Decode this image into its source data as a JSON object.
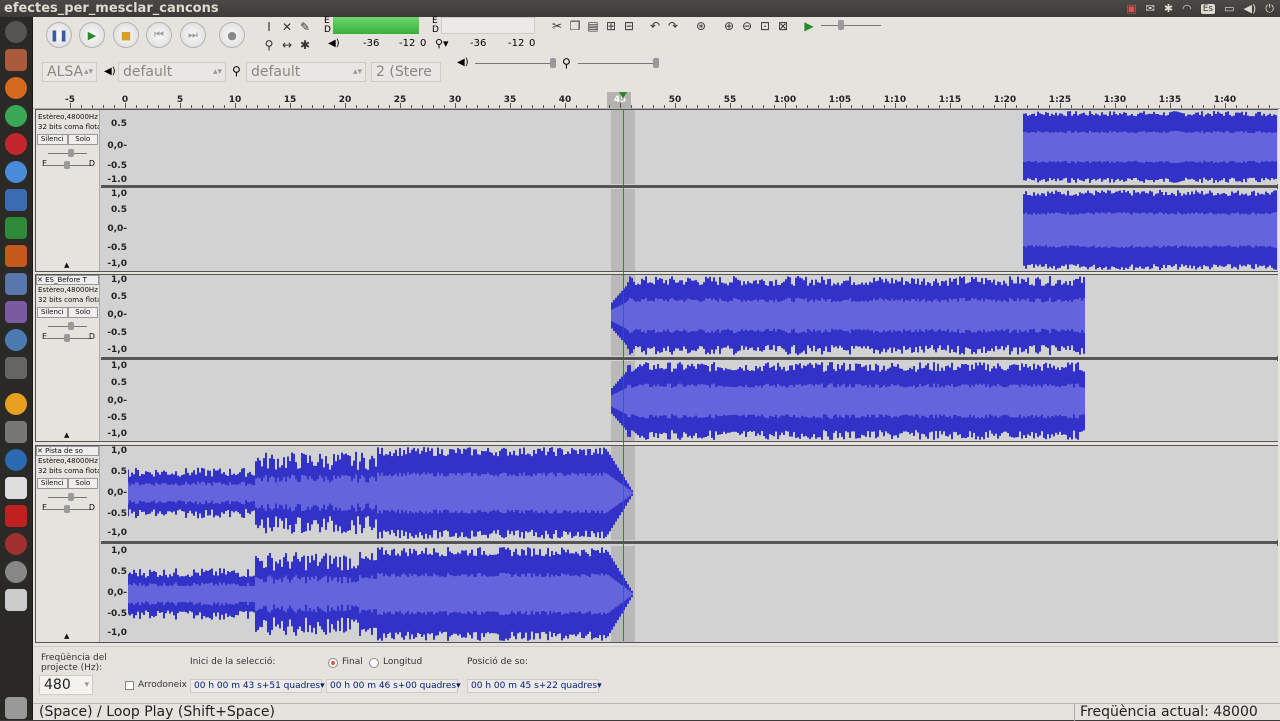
{
  "window": {
    "title": "efectes_per_mesclar_cancons"
  },
  "tray": {
    "lang": "Es"
  },
  "transport": {
    "pause": "pause-icon",
    "play": "play-icon",
    "stop": "stop-icon",
    "skip_start": "skip-start-icon",
    "skip_end": "skip-end-icon",
    "record": "record-icon"
  },
  "meters": {
    "rec_letters": [
      "E",
      "D"
    ],
    "play_letters": [
      "E",
      "D"
    ],
    "rec_scale": [
      "-36",
      "-12",
      "0"
    ],
    "play_scale": [
      "-36",
      "-12",
      "0"
    ]
  },
  "devices": {
    "host": "ALSA",
    "output_device": "default",
    "input_device": "default",
    "channels": "2 (Stere"
  },
  "ruler": {
    "labels": [
      "-5",
      "0",
      "5",
      "10",
      "15",
      "20",
      "25",
      "30",
      "35",
      "40",
      "45",
      "50",
      "55",
      "1:00",
      "1:05",
      "1:10",
      "1:15",
      "1:20",
      "1:25",
      "1:30",
      "1:35",
      "1:40"
    ],
    "current": "45"
  },
  "tracks": [
    {
      "name": "",
      "info1": "Estèreo,48000Hz",
      "info2": "32 bits coma flotant",
      "mute": "Silenci",
      "solo": "Solo",
      "pan_l": "E",
      "pan_r": "D",
      "scale_top": [
        "0.5",
        "0,0-",
        "-0.5",
        "-1.0"
      ],
      "scale_bottom": [
        "1,0",
        "0.5",
        "0,0-",
        "-0.5",
        "-1,0"
      ]
    },
    {
      "name": "ES_Before T",
      "info1": "Estèreo,48000Hz",
      "info2": "32 bits coma flotant",
      "mute": "Silenci",
      "solo": "Solo",
      "pan_l": "E",
      "pan_r": "D",
      "scale_top": [
        "1,0",
        "0.5",
        "0,0-",
        "-0.5",
        "-1,0"
      ],
      "scale_bottom": [
        "1,0",
        "0.5",
        "0,0-",
        "-0.5",
        "-1,0"
      ]
    },
    {
      "name": "Pista de so",
      "info1": "Estèreo,48000Hz",
      "info2": "32 bits coma flotant",
      "mute": "Silenci",
      "solo": "Solo",
      "pan_l": "E",
      "pan_r": "D",
      "scale_top": [
        "1,0",
        "0.5",
        "0,0-",
        "-0.5",
        "-1,0"
      ],
      "scale_bottom": [
        "1,0",
        "0.5",
        "0,0-",
        "-0.5",
        "-1,0"
      ]
    }
  ],
  "selection": {
    "rate_label": "Freqüència del projecte (Hz):",
    "rate_value": "480",
    "snap_label": "Arrodoneix",
    "start_label": "Inici de la selecció:",
    "end_option": "Final",
    "length_option": "Longitud",
    "pos_label": "Posició de so:",
    "start_time": "00 h 00 m 43 s+51 quadres",
    "end_time": "00 h 00 m 46 s+00 quadres",
    "pos_time": "00 h 00 m 45 s+22 quadres"
  },
  "status": {
    "left": "(Space) / Loop Play (Shift+Space)",
    "right": "Freqüència actual: 48000"
  },
  "colors": {
    "wave": "#3232c8",
    "wave_inner": "#6464dc",
    "track_bg": "#d2d2d2",
    "selected_bg": "#b9b9b9"
  }
}
